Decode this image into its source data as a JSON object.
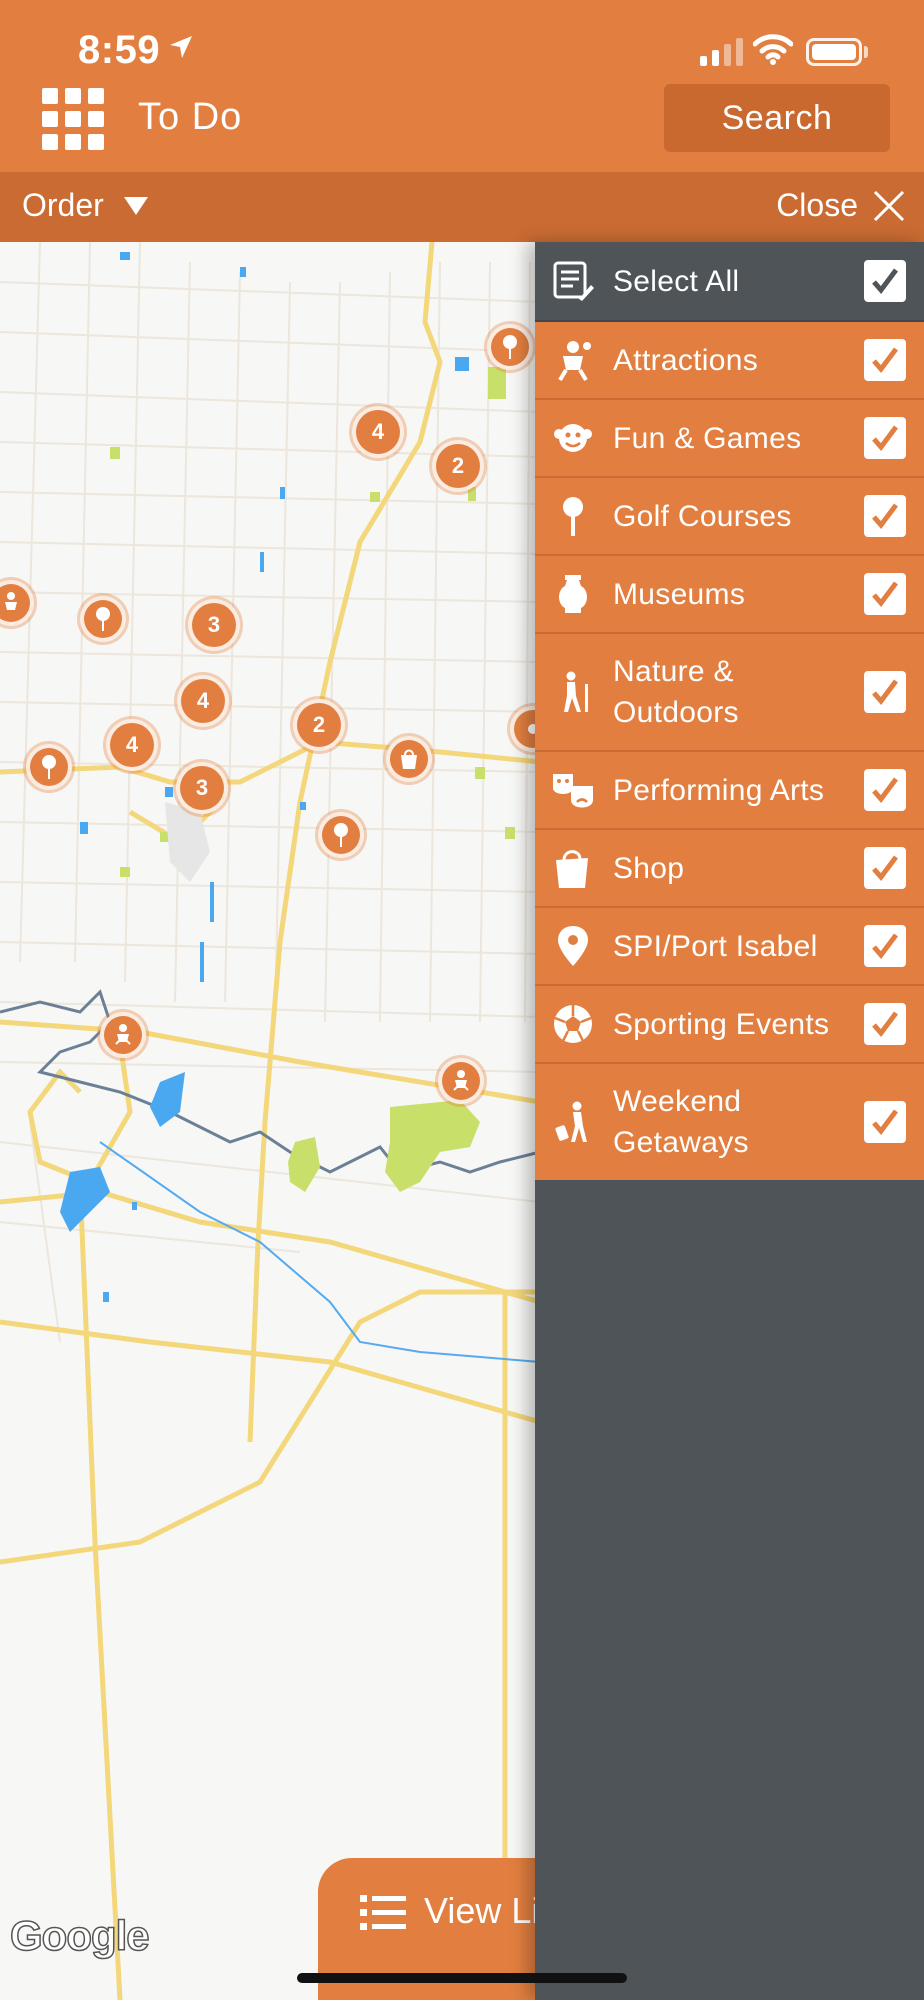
{
  "status_bar": {
    "time": "8:59"
  },
  "header": {
    "title": "To Do",
    "search_label": "Search"
  },
  "subbar": {
    "order_label": "Order",
    "close_label": "Close"
  },
  "map": {
    "clusters": [
      "4",
      "2",
      "3",
      "4",
      "4",
      "2",
      "3"
    ],
    "logo_text": "Google"
  },
  "view_list": {
    "label": "View Li"
  },
  "filter_panel": {
    "select_all": {
      "label": "Select All",
      "checked": true
    },
    "categories": [
      {
        "label": "Attractions",
        "icon": "attractions-icon",
        "checked": true
      },
      {
        "label": "Fun & Games",
        "icon": "fun-games-icon",
        "checked": true
      },
      {
        "label": "Golf Courses",
        "icon": "golf-icon",
        "checked": true
      },
      {
        "label": "Museums",
        "icon": "museum-icon",
        "checked": true
      },
      {
        "label": "Nature &\nOutdoors",
        "icon": "hiker-icon",
        "checked": true
      },
      {
        "label": "Performing Arts",
        "icon": "theater-masks-icon",
        "checked": true
      },
      {
        "label": "Shop",
        "icon": "shopping-bag-icon",
        "checked": true
      },
      {
        "label": "SPI/Port Isabel",
        "icon": "location-pin-icon",
        "checked": true
      },
      {
        "label": "Sporting Events",
        "icon": "soccer-ball-icon",
        "checked": true
      },
      {
        "label": "Weekend\nGetaways",
        "icon": "traveler-icon",
        "checked": true
      }
    ]
  },
  "colors": {
    "brand": "#e27f40",
    "brand_dark": "#c96b33",
    "panel_dark": "#4f5459"
  }
}
